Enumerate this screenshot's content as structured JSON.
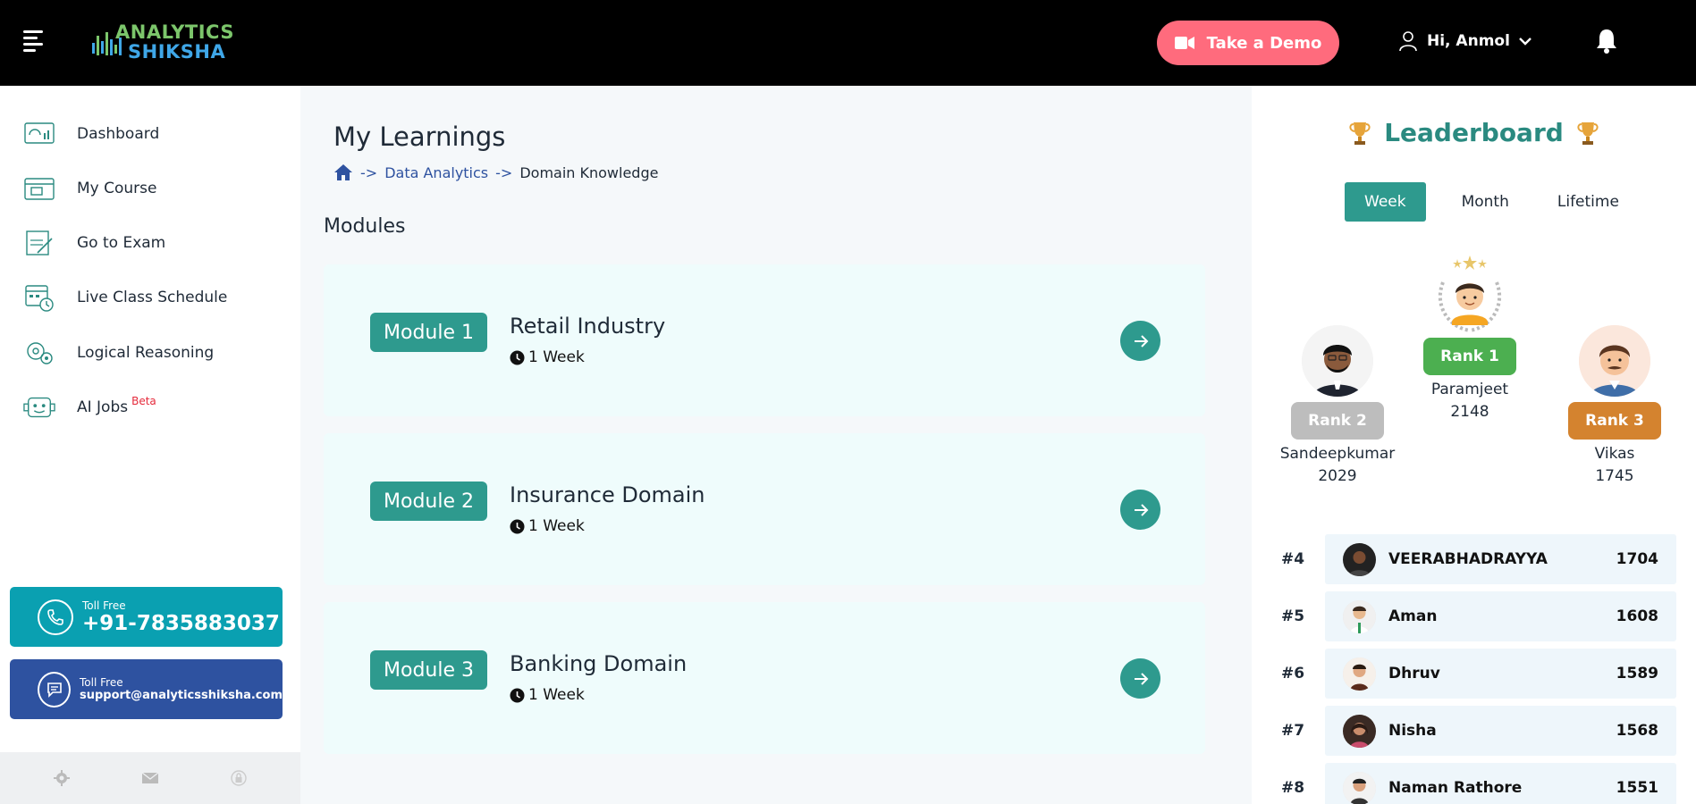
{
  "header": {
    "logo_line1": "ANALYTICS",
    "logo_line2": "SHIKSHA",
    "demo_label": "Take a Demo",
    "user_greeting": "Hi, Anmol"
  },
  "sidebar": {
    "items": [
      {
        "label": "Dashboard",
        "icon": "dashboard-icon"
      },
      {
        "label": "My Course",
        "icon": "course-icon"
      },
      {
        "label": "Go to Exam",
        "icon": "exam-icon"
      },
      {
        "label": "Live Class Schedule",
        "icon": "calendar-icon"
      },
      {
        "label": "Logical Reasoning",
        "icon": "brain-gears-icon"
      },
      {
        "label": "AI Jobs",
        "icon": "robot-icon",
        "badge": "Beta"
      }
    ],
    "phone": {
      "caption": "Toll Free",
      "value": "+91-7835883037"
    },
    "mail": {
      "caption": "Toll Free",
      "value": "support@analyticsshiksha.com"
    }
  },
  "main": {
    "title": "My Learnings",
    "breadcrumb": {
      "sep": "->",
      "link": "Data Analytics",
      "current": "Domain Knowledge"
    },
    "section_title": "Modules",
    "modules": [
      {
        "badge": "Module 1",
        "name": "Retail Industry",
        "duration": "1 Week"
      },
      {
        "badge": "Module 2",
        "name": "Insurance Domain",
        "duration": "1 Week"
      },
      {
        "badge": "Module 3",
        "name": "Banking Domain",
        "duration": "1 Week"
      }
    ]
  },
  "leaderboard": {
    "title": "Leaderboard",
    "tabs": [
      "Week",
      "Month",
      "Lifetime"
    ],
    "active_tab": "Week",
    "podium": {
      "first": {
        "rank": "Rank 1",
        "name": "Paramjeet",
        "points": "2148",
        "color": "#4caf50"
      },
      "second": {
        "rank": "Rank 2",
        "name": "Sandeepkumar",
        "points": "2029",
        "color": "#bdbdbd"
      },
      "third": {
        "rank": "Rank 3",
        "name": "Vikas",
        "points": "1745",
        "color": "#d4832f"
      }
    },
    "rows": [
      {
        "pos": "#4",
        "name": "VEERABHADRAYYA",
        "points": "1704"
      },
      {
        "pos": "#5",
        "name": "Aman",
        "points": "1608"
      },
      {
        "pos": "#6",
        "name": "Dhruv",
        "points": "1589"
      },
      {
        "pos": "#7",
        "name": "Nisha",
        "points": "1568"
      },
      {
        "pos": "#8",
        "name": "Naman Rathore",
        "points": "1551"
      }
    ]
  },
  "colors": {
    "accent": "#2e9a8e",
    "demo": "#ff6b7d",
    "phone": "#0aa0b1",
    "mail": "#2e52a0"
  }
}
